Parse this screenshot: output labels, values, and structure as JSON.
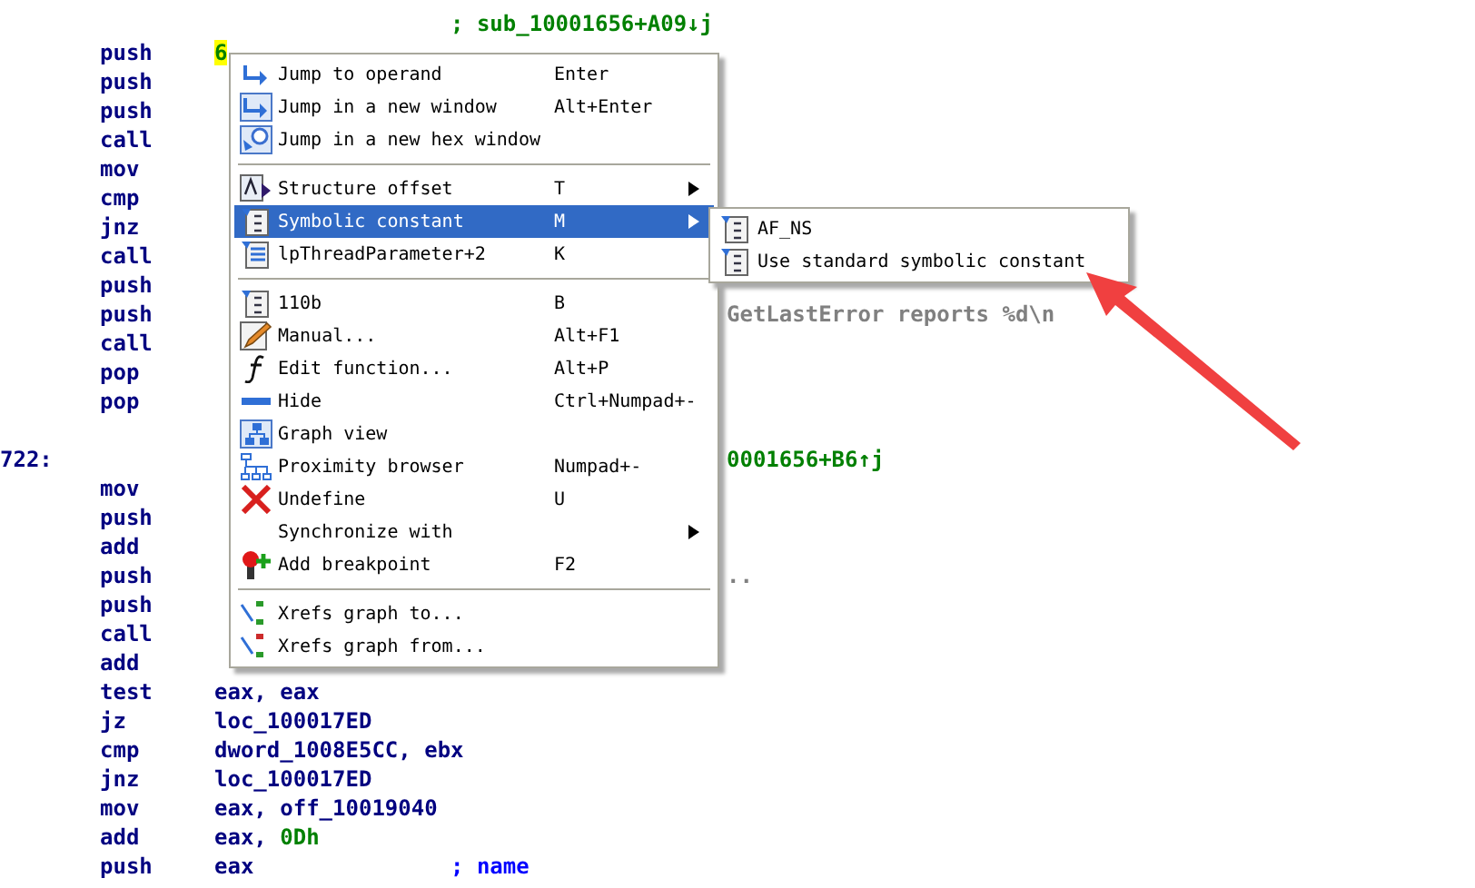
{
  "listing": [
    {
      "xref_comment": "; sub_10001656+A09↓j",
      "highlighted": false
    },
    {
      "mnemonic": "push",
      "operand": "6",
      "highlighted": true
    },
    {
      "mnemonic": "push",
      "highlighted": false
    },
    {
      "mnemonic": "push",
      "highlighted": false
    },
    {
      "mnemonic": "call",
      "highlighted": false
    },
    {
      "mnemonic": "mov",
      "highlighted": false
    },
    {
      "mnemonic": "cmp",
      "highlighted": false
    },
    {
      "mnemonic": "jnz",
      "highlighted": false
    },
    {
      "mnemonic": "call",
      "highlighted": false
    },
    {
      "mnemonic": "push",
      "highlighted": false
    },
    {
      "mnemonic": "push",
      "string_comment": "GetLastError reports %d\\n",
      "highlighted": false
    },
    {
      "mnemonic": "call",
      "highlighted": false
    },
    {
      "mnemonic": "pop",
      "highlighted": false
    },
    {
      "mnemonic": "pop",
      "highlighted": false
    },
    {
      "highlighted": false
    },
    {
      "label": "722:",
      "xref_comment": "0001656+B6↑j",
      "highlighted": false
    },
    {
      "mnemonic": "mov",
      "highlighted": false
    },
    {
      "mnemonic": "push",
      "highlighted": false
    },
    {
      "mnemonic": "add",
      "highlighted": false
    },
    {
      "mnemonic": "push",
      "string_comment": "..",
      "highlighted": false
    },
    {
      "mnemonic": "push",
      "highlighted": false
    },
    {
      "mnemonic": "call",
      "highlighted": false
    },
    {
      "mnemonic": "add",
      "highlighted": false
    },
    {
      "mnemonic": "test",
      "operand": "eax, eax",
      "highlighted": false
    },
    {
      "mnemonic": "jz",
      "operand": "loc_100017ED",
      "highlighted": false
    },
    {
      "mnemonic": "cmp",
      "operand": "dword_1008E5CC, ebx",
      "highlighted": false
    },
    {
      "mnemonic": "jnz",
      "operand": "loc_100017ED",
      "highlighted": false
    },
    {
      "mnemonic": "mov",
      "operand": "eax, off_10019040",
      "highlighted": false
    },
    {
      "mnemonic": "add",
      "operand": "eax, ",
      "constant": "0Dh",
      "highlighted": false
    },
    {
      "mnemonic": "push",
      "operand": "eax",
      "name_comment": "; name",
      "highlighted": false
    }
  ],
  "context_menu": [
    {
      "kind": "jump",
      "label": "Jump to operand",
      "shortcut": "Enter",
      "submenu": false,
      "selected": false
    },
    {
      "kind": "jump-window",
      "label": "Jump in a new window",
      "shortcut": "Alt+Enter",
      "submenu": false,
      "selected": false
    },
    {
      "kind": "hex",
      "label": "Jump in a new hex window",
      "submenu": false,
      "selected": false
    },
    {
      "kind": "separator"
    },
    {
      "kind": "struct",
      "label": "Structure offset",
      "shortcut": "T",
      "submenu": true,
      "selected": false
    },
    {
      "kind": "const",
      "label": "Symbolic constant",
      "shortcut": "M",
      "submenu": true,
      "selected": true
    },
    {
      "kind": "enum",
      "label": "lpThreadParameter+2",
      "shortcut": "K",
      "submenu": false,
      "selected": false
    },
    {
      "kind": "separator"
    },
    {
      "kind": "binary",
      "label": "110b",
      "shortcut": "B",
      "submenu": false,
      "selected": false
    },
    {
      "kind": "pencil",
      "label": "Manual...",
      "shortcut": "Alt+F1",
      "submenu": false,
      "selected": false
    },
    {
      "kind": "function",
      "label": "Edit function...",
      "shortcut": "Alt+P",
      "submenu": false,
      "selected": false
    },
    {
      "kind": "hide",
      "label": "Hide",
      "shortcut": "Ctrl+Numpad+-",
      "submenu": false,
      "selected": false
    },
    {
      "kind": "graph",
      "label": "Graph view",
      "submenu": false,
      "selected": false
    },
    {
      "kind": "tree",
      "label": "Proximity browser",
      "shortcut": "Numpad+-",
      "submenu": false,
      "selected": false
    },
    {
      "kind": "cross",
      "label": "Undefine",
      "shortcut": "U",
      "submenu": false,
      "selected": false
    },
    {
      "kind": "none",
      "label": "Synchronize with",
      "submenu": true,
      "selected": false
    },
    {
      "kind": "breakpoint",
      "label": "Add breakpoint",
      "shortcut": "F2",
      "submenu": false,
      "selected": false
    },
    {
      "kind": "separator"
    },
    {
      "kind": "xrefs-to",
      "label": "Xrefs graph to...",
      "submenu": false,
      "selected": false
    },
    {
      "kind": "xrefs-from",
      "label": "Xrefs graph from...",
      "submenu": false,
      "selected": false
    }
  ],
  "submenu": [
    {
      "kind": "const",
      "label": "AF_NS",
      "selected": false
    },
    {
      "kind": "const",
      "label": "Use standard symbolic constant",
      "selected": false
    }
  ]
}
